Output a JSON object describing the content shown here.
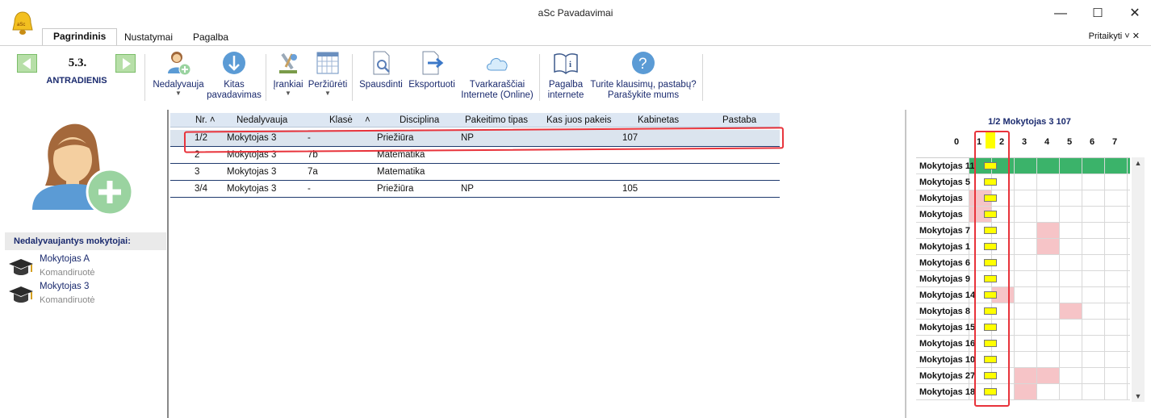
{
  "window": {
    "title": "aSc Pavadavimai",
    "minimize": "—",
    "maximize": "☐",
    "close": "✕"
  },
  "tabs": [
    "Pagrindinis",
    "Nustatymai",
    "Pagalba"
  ],
  "customize_label": "Pritaikyti ˅ ✕",
  "date": {
    "number": "5.3.",
    "day": "ANTRADIENIS"
  },
  "ribbon": {
    "absent_label": "Nedalyvauja",
    "other_sub_label": "Kitas pavadavimas",
    "tools_label": "Įrankiai",
    "view_label": "Peržiūrėti",
    "print_label": "Spausdinti",
    "export_label": "Eksportuoti",
    "online_label": "Tvarkaraščiai Internete (Online)",
    "help_label": "Pagalba internete",
    "questions_label": "Turite klausimų, pastabų? Parašykite mums"
  },
  "left": {
    "section_title": "Nedalyvaujantys mokytojai:",
    "teachers": [
      {
        "name": "Mokytojas A",
        "status": "Komandiruotė"
      },
      {
        "name": "Mokytojas 3",
        "status": "Komandiruotė"
      }
    ]
  },
  "grid": {
    "headers": [
      "Nr. ˄",
      "Nedalyvauja",
      "Klasė",
      "˄",
      "Disciplina",
      "Pakeitimo tipas",
      "Kas juos pakeis",
      "Kabinetas",
      "Pastaba"
    ],
    "rows": [
      {
        "nr": "1/2",
        "absent": "Mokytojas 3",
        "klase": "-",
        "disc": "Priežiūra",
        "type": "NP",
        "who": "",
        "room": "107",
        "note": ""
      },
      {
        "nr": "2",
        "absent": "Mokytojas 3",
        "klase": "7b",
        "disc": "Matematika",
        "type": "",
        "who": "",
        "room": "",
        "note": ""
      },
      {
        "nr": "3",
        "absent": "Mokytojas 3",
        "klase": "7a",
        "disc": "Matematika",
        "type": "",
        "who": "",
        "room": "",
        "note": ""
      },
      {
        "nr": "3/4",
        "absent": "Mokytojas 3",
        "klase": "-",
        "disc": "Priežiūra",
        "type": "NP",
        "who": "",
        "room": "105",
        "note": ""
      }
    ]
  },
  "right": {
    "title": "1/2 Mokytojas 3 107",
    "periods": [
      "0",
      "1",
      "2",
      "3",
      "4",
      "5",
      "6",
      "7"
    ],
    "teachers": [
      "Mokytojas 11",
      "Mokytojas 5",
      "Mokytojas",
      "Mokytojas",
      "Mokytojas 7",
      "Mokytojas 1",
      "Mokytojas 6",
      "Mokytojas 9",
      "Mokytojas 14",
      "Mokytojas 8",
      "Mokytojas 15",
      "Mokytojas 16",
      "Mokytojas 10",
      "Mokytojas 27",
      "Mokytojas 18"
    ]
  },
  "colors": {
    "accent_green": "#3bb36a",
    "busy_pink": "#f6c4c7",
    "free_yellow": "#ffff00",
    "highlight_red": "#e8333b",
    "text_blue": "#1a2a6e"
  }
}
